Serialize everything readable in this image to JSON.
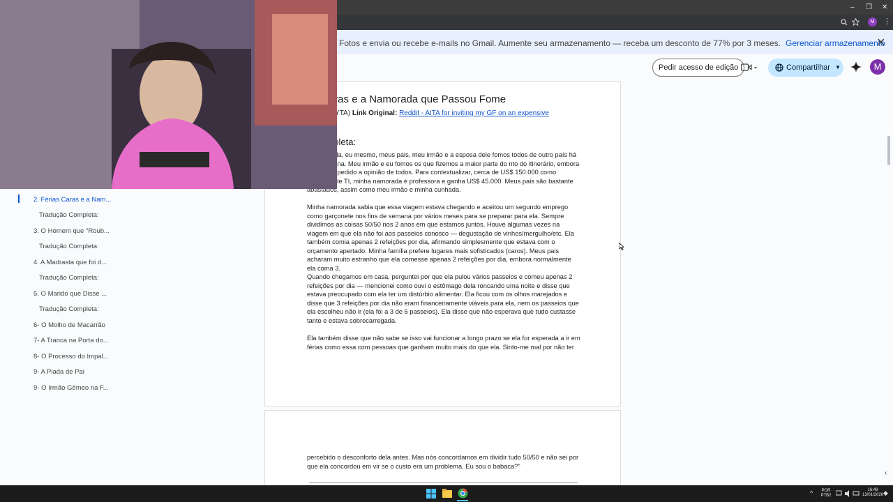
{
  "browser": {
    "window_controls": [
      "–",
      "❐",
      "✕"
    ],
    "profile_initial": "M"
  },
  "banner": {
    "message": "Fotos e envia ou recebe e-mails no Gmail. Aumente seu armazenamento — receba um desconto de 77% por 3 meses.",
    "manage_label": "Gerenciar armazenamento",
    "close_icon": "✕"
  },
  "toolbar": {
    "request_edit_label": "Pedir acesso de edição",
    "share_label": "Compartilhar",
    "avatar_initial": "M"
  },
  "outline": {
    "items": [
      {
        "label": "2. Férias Caras e a Nam...",
        "active": true
      },
      {
        "label": "Tradução Completa:"
      },
      {
        "label": "3. O Homem que \"Roub..."
      },
      {
        "label": "Tradução Completa:"
      },
      {
        "label": "4. A Madrasta que foi d..."
      },
      {
        "label": "Tradução Completa:"
      },
      {
        "label": "5. O Marido que Disse ..."
      },
      {
        "label": "Tradução Completa:"
      },
      {
        "label": "6- O Molho de Macarrão"
      },
      {
        "label": "7- A Tranca na Porta do..."
      },
      {
        "label": "8- O Processo do Impal..."
      },
      {
        "label": "9- A Piada de Pai"
      },
      {
        "label": "9- O Irmão Gêmeo na F..."
      }
    ]
  },
  "document": {
    "title": "as Caras e a Namorada que Passou Fome",
    "meta_prefix": "Babaca (YTA)",
    "link_label": "Link Original:",
    "link_text": "Reddit - AITA for inviting my GF on an expensive",
    "section_heading": "o Completa:",
    "paragraphs": [
      "a namorada, eu mesmo, meus pais, meu irmão e a esposa dele fomos todos de outro país há uma semana. Meu irmão e eu fomos os que fizemos a maior parte do nto do itinerário, embora tenhamos pedido a opinião de todos. Para contextualizar, cerca de US$ 150.000 como consultor de TI, minha namorada é professora e ganha US$ 45.000. Meus pais são bastante abastados, assim como meu irmão e minha cunhada.",
      "Minha namorada sabia que essa viagem estava chegando e aceitou um segundo emprego como garçonete nos fins de semana por vários meses para se preparar para ela. Sempre dividimos as coisas 50/50 nos 2 anos em que estamos juntos. Houve algumas vezes na viagem em que ela não foi aos passeios conosco — degustação de vinhos/mergulho/etc. Ela também comia apenas 2 refeições por dia, afirmando simplesmente que estava com o orçamento apertado. Minha família prefere lugares mais sofisticados (caros). Meus pais acharam muito estranho que ela comesse apenas 2 refeições por dia, embora normalmente ela coma 3.",
      "Quando chegamos em casa, perguntei por que ela pulou vários passeios e comeu apenas 2 refeições por dia — mencionei como ouvi o estômago dela roncando uma noite e disse que estava preocupado com ela ter um distúrbio alimentar. Ela ficou com os olhos marejados e disse que 3 refeições por dia não eram financeiramente viáveis para ela, nem os passeios que ela escolheu não ir (ela foi a 3 de 6 passeios). Ela disse que não esperava que tudo custasse tanto e estava sobrecarregada.",
      "Ela também disse que não sabe se isso vai funcionar a longo prazo se ela for esperada a ir em férias como essa com pessoas que ganham muito mais do que ela. Sinto-me mal por não ter",
      "percebido o desconforto dela antes. Mas nós concordamos em dividir tudo 50/50 e não sei por que ela concordou em vir se o custo era um problema. Eu sou o babaca?\""
    ]
  },
  "taskbar": {
    "lang_top": "POR",
    "lang_bottom": "PTB2",
    "time": "16:48",
    "date": "13/01/2026"
  },
  "colors": {
    "accent": "#0b57d0",
    "banner_bg": "#e8f0fe",
    "share_bg": "#c2e7ff",
    "avatar": "#7b2fa8"
  }
}
